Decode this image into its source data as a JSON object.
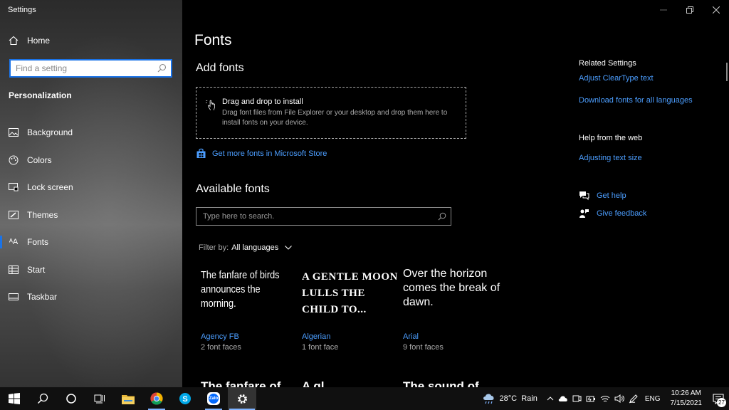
{
  "app": {
    "title": "Settings"
  },
  "sidebar": {
    "home_label": "Home",
    "search_placeholder": "Find a setting",
    "section_title": "Personalization",
    "items": [
      {
        "label": "Background",
        "icon": "picture-icon"
      },
      {
        "label": "Colors",
        "icon": "palette-icon"
      },
      {
        "label": "Lock screen",
        "icon": "lock-screen-icon"
      },
      {
        "label": "Themes",
        "icon": "brush-icon"
      },
      {
        "label": "Fonts",
        "icon": "font-icon",
        "active": true
      },
      {
        "label": "Start",
        "icon": "start-layout-icon"
      },
      {
        "label": "Taskbar",
        "icon": "taskbar-icon"
      }
    ]
  },
  "main": {
    "title": "Fonts",
    "add_fonts": {
      "heading": "Add fonts",
      "drop_title": "Drag and drop to install",
      "drop_desc": "Drag font files from File Explorer or your desktop and drop them here to install fonts on your device.",
      "store_link": "Get more fonts in Microsoft Store"
    },
    "available": {
      "heading": "Available fonts",
      "search_placeholder": "Type here to search.",
      "filter_label": "Filter by:",
      "filter_value": "All languages"
    },
    "fonts": [
      {
        "preview": "The fanfare of birds announces the morning.",
        "name": "Agency FB",
        "faces": "2 font faces"
      },
      {
        "preview": "A gentle moon lulls the child to...",
        "name": "Algerian",
        "faces": "1 font face"
      },
      {
        "preview": "Over the horizon comes the break of dawn.",
        "name": "Arial",
        "faces": "9 font faces"
      }
    ],
    "partial_previews": [
      "The fanfare of",
      "A gl",
      "The sound of"
    ]
  },
  "related": {
    "heading": "Related Settings",
    "link1": "Adjust ClearType text",
    "link2": "Download fonts for all languages",
    "help_heading": "Help from the web",
    "help_link": "Adjusting text size",
    "get_help": "Get help",
    "give_feedback": "Give feedback"
  },
  "taskbar": {
    "weather": "28°C  Rain",
    "lang": "ENG",
    "time": "10:26 AM",
    "date": "7/15/2021",
    "notifications": "27",
    "zalo_label": "Zalo"
  },
  "colors": {
    "accent": "#1a73e8",
    "link": "#4c9eff"
  }
}
